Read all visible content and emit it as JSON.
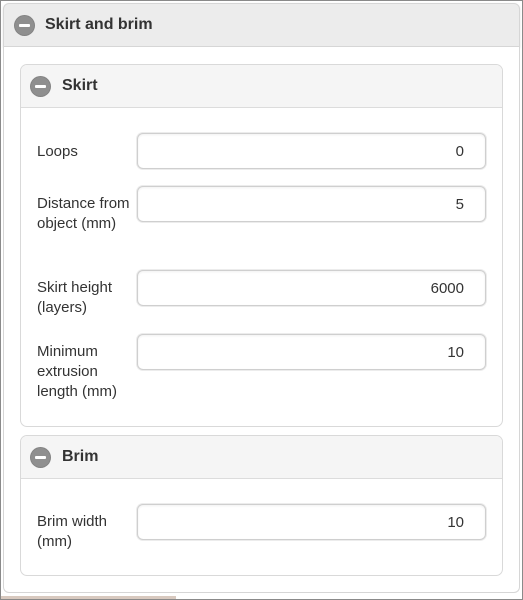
{
  "panel": {
    "title": "Skirt and brim"
  },
  "skirt": {
    "title": "Skirt",
    "fields": [
      {
        "label": "Loops",
        "value": "0"
      },
      {
        "label": "Distance from object (mm)",
        "value": "5"
      },
      {
        "label": "Skirt height (layers)",
        "value": "6000"
      },
      {
        "label": "Minimum extrusion length (mm)",
        "value": "10"
      }
    ]
  },
  "brim": {
    "title": "Brim",
    "fields": [
      {
        "label": "Brim width (mm)",
        "value": "10"
      }
    ]
  },
  "icons": {
    "collapse": "minus-circle-icon"
  }
}
